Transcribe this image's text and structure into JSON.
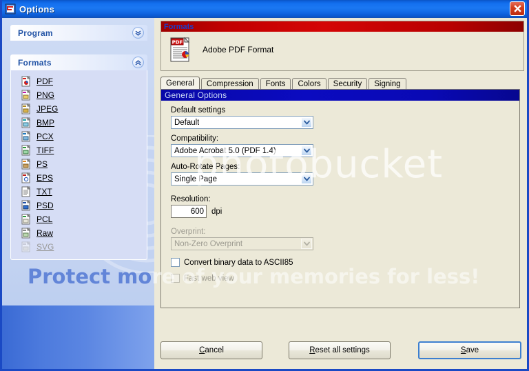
{
  "window": {
    "title": "Options",
    "icon": "app-icon",
    "close_label": "×"
  },
  "sidebar": {
    "panels": [
      {
        "title": "Program",
        "chevron": "chevron-double-down-icon",
        "expanded": false
      },
      {
        "title": "Formats",
        "chevron": "chevron-double-up-icon",
        "expanded": true
      }
    ],
    "formats": [
      {
        "label": "PDF",
        "icon": "file-pdf-icon",
        "disabled": false
      },
      {
        "label": "PNG",
        "icon": "file-png-icon",
        "disabled": false
      },
      {
        "label": "JPEG",
        "icon": "file-jpeg-icon",
        "disabled": false
      },
      {
        "label": "BMP",
        "icon": "file-bmp-icon",
        "disabled": false
      },
      {
        "label": "PCX",
        "icon": "file-pcx-icon",
        "disabled": false
      },
      {
        "label": "TIFF",
        "icon": "file-tiff-icon",
        "disabled": false
      },
      {
        "label": "PS",
        "icon": "file-ps-icon",
        "disabled": false
      },
      {
        "label": "EPS",
        "icon": "file-eps-icon",
        "disabled": false
      },
      {
        "label": "TXT",
        "icon": "file-txt-icon",
        "disabled": false
      },
      {
        "label": "PSD",
        "icon": "file-psd-icon",
        "disabled": false
      },
      {
        "label": "PCL",
        "icon": "file-pcl-icon",
        "disabled": false
      },
      {
        "label": "Raw",
        "icon": "file-raw-icon",
        "disabled": false
      },
      {
        "label": "SVG",
        "icon": "file-svg-icon",
        "disabled": true
      }
    ]
  },
  "formats_header": {
    "title": "Formats",
    "selected_format": "Adobe PDF Format",
    "icon": "pdf-document-icon"
  },
  "tabs": [
    {
      "label": "General",
      "active": true
    },
    {
      "label": "Compression",
      "active": false
    },
    {
      "label": "Fonts",
      "active": false
    },
    {
      "label": "Colors",
      "active": false
    },
    {
      "label": "Security",
      "active": false
    },
    {
      "label": "Signing",
      "active": false
    }
  ],
  "general_options": {
    "group_title": "General Options",
    "default_settings": {
      "label": "Default settings",
      "value": "Default",
      "disabled": false
    },
    "compatibility": {
      "label": "Compatibility:",
      "value": "Adobe Acrobat 5.0 (PDF 1.4)",
      "disabled": false
    },
    "auto_rotate": {
      "label": "Auto-Rotate Pages:",
      "value": "Single Page",
      "disabled": false
    },
    "resolution": {
      "label": "Resolution:",
      "value": "600",
      "unit": "dpi"
    },
    "overprint": {
      "label": "Overprint:",
      "value": "Non-Zero Overprint",
      "disabled": true
    },
    "convert_binary": {
      "label": "Convert binary data to ASCII85",
      "checked": false,
      "disabled": false
    },
    "fast_web_view": {
      "label": "Fast web view",
      "checked": false,
      "disabled": true
    }
  },
  "footer": {
    "cancel": {
      "accel": "C",
      "rest": "ancel"
    },
    "reset": {
      "accel": "R",
      "rest": "eset all settings"
    },
    "save": {
      "accel": "S",
      "rest": "ave"
    }
  },
  "watermark": {
    "brand": "photobucket",
    "tagline_blue": "Protect mo",
    "tagline_cream": "re of your memories for less!"
  },
  "colors": {
    "titlebar": "#1470ef",
    "close": "#d4401f",
    "formats_header": "#c20000",
    "group_header": "#0b0bc0",
    "sidebar": "#c6d5f2",
    "dialog": "#ece9d8",
    "default_button_border": "#3c7fd0"
  }
}
